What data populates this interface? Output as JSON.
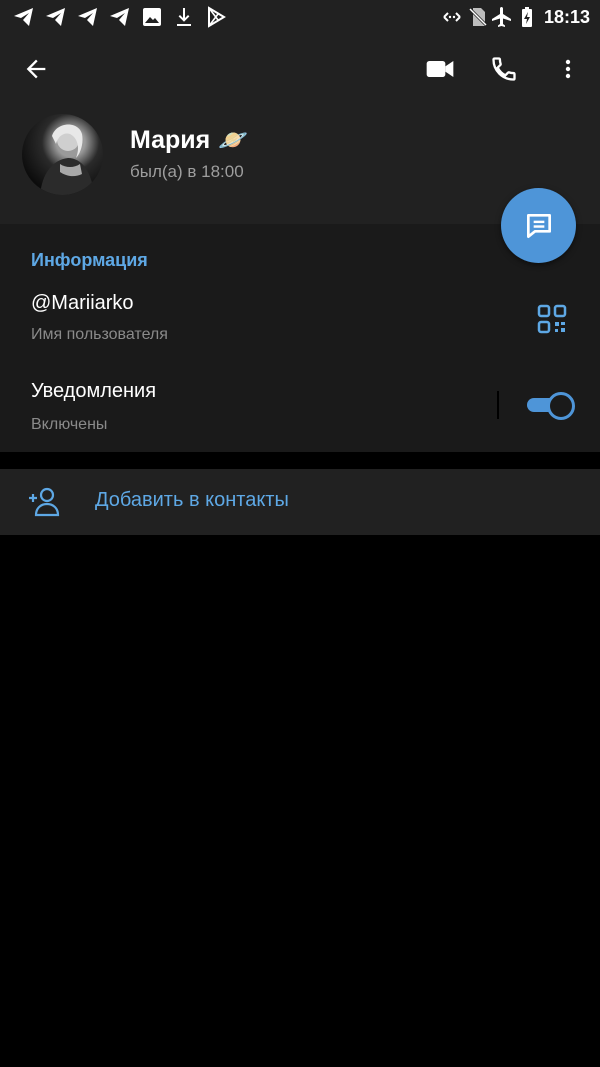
{
  "status_bar": {
    "time": "18:13",
    "left_icons": [
      "telegram-icon",
      "telegram-icon",
      "telegram-icon",
      "telegram-icon",
      "gallery-icon",
      "download-icon",
      "play-store-icon"
    ],
    "right_icons": [
      "data-saver-icon",
      "no-sim-icon",
      "airplane-icon",
      "battery-charging-icon"
    ]
  },
  "header": {
    "back_icon": "arrow-left",
    "video_icon": "video-call",
    "call_icon": "phone",
    "more_icon": "more-vertical",
    "name": "Мария",
    "emoji": "🪐",
    "status": "был(а) в 18:00",
    "fab_icon": "message"
  },
  "info": {
    "section_title": "Информация",
    "username": "@Mariiarko",
    "username_label": "Имя пользователя",
    "notifications_label": "Уведомления",
    "notifications_value": "Включены",
    "notifications_on": true
  },
  "actions": {
    "add_contact_label": "Добавить в контакты"
  },
  "colors": {
    "accent": "#5ea8e5",
    "fab": "#4e95d8",
    "header_bg": "#212121",
    "section_bg": "#1a1a1a"
  }
}
